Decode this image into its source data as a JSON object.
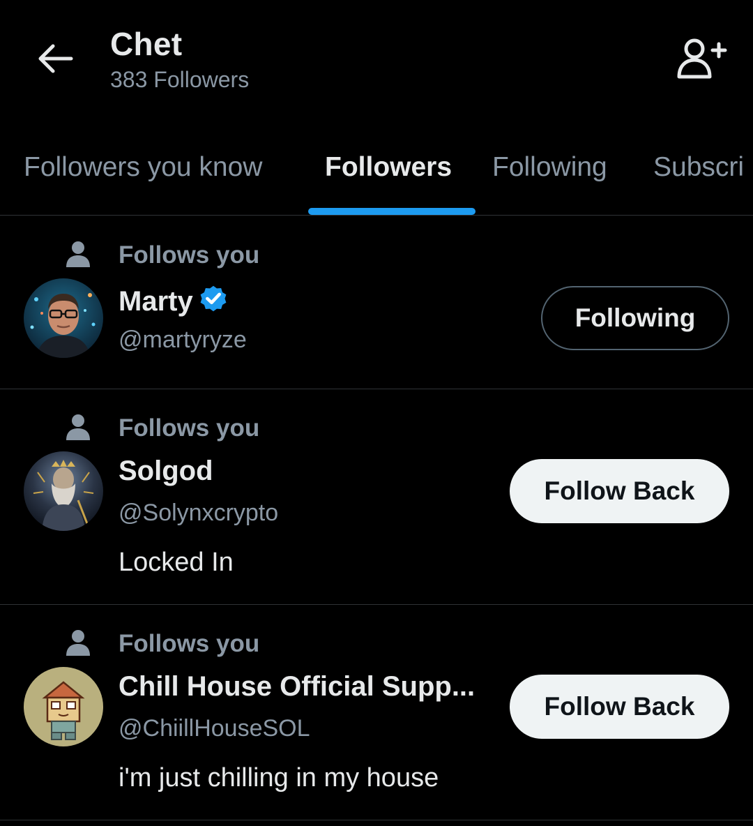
{
  "header": {
    "title": "Chet",
    "subtitle": "383 Followers",
    "back_icon": "arrow-left-icon",
    "add_icon": "add-user-icon"
  },
  "tabs": [
    {
      "label": "Followers you know",
      "active": false
    },
    {
      "label": "Followers",
      "active": true
    },
    {
      "label": "Following",
      "active": false
    },
    {
      "label": "Subscri",
      "active": false
    }
  ],
  "colors": {
    "accent": "#1d9bf0",
    "background": "#000000",
    "muted": "#8b98a5",
    "text": "#e7e9ea"
  },
  "users": [
    {
      "follows_label": "Follows you",
      "name": "Marty",
      "verified": true,
      "handle": "@martyryze",
      "bio": "",
      "button": "Following"
    },
    {
      "follows_label": "Follows you",
      "name": "Solgod",
      "verified": false,
      "handle": "@Solynxcrypto",
      "bio": "Locked In",
      "button": "Follow Back"
    },
    {
      "follows_label": "Follows you",
      "name": "Chill House Official Supp...",
      "verified": false,
      "handle": "@ChiillHouseSOL",
      "bio": "i'm just chilling in my house",
      "button": "Follow Back"
    }
  ]
}
